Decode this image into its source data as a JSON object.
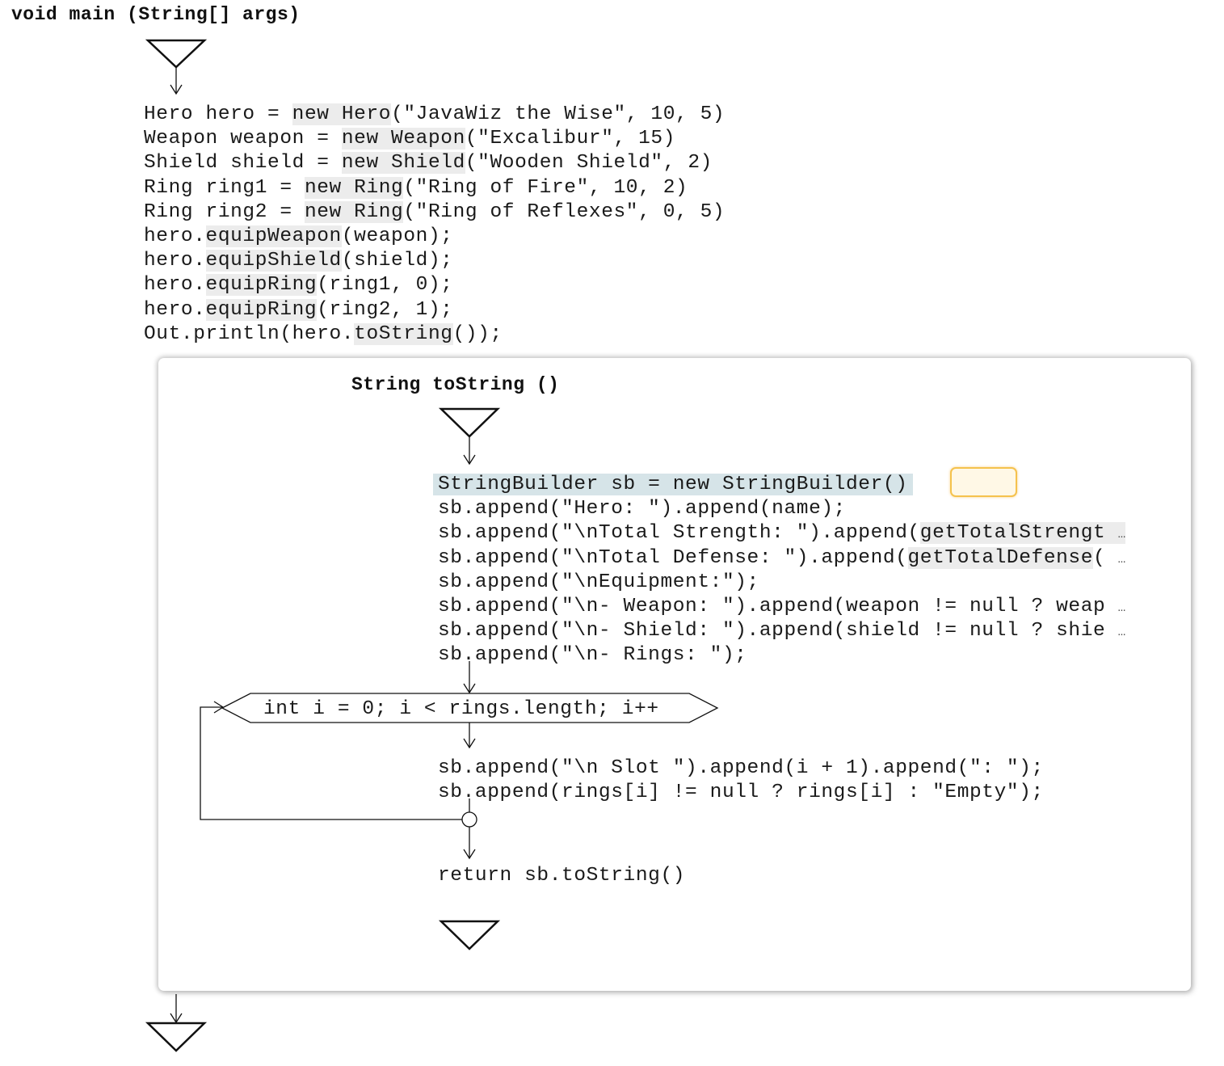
{
  "main_method": {
    "signature": "void main (String[] args)",
    "lines": [
      {
        "text": "Hero hero = new Hero(\"JavaWiz the Wise\", 10, 5)"
      },
      {
        "text": "Weapon weapon = new Weapon(\"Excalibur\", 15)"
      },
      {
        "text": "Shield shield = new Shield(\"Wooden Shield\", 2)"
      },
      {
        "text": "Ring ring1 = new Ring(\"Ring of Fire\", 10, 2)"
      },
      {
        "text": "Ring ring2 = new Ring(\"Ring of Reflexes\", 0, 5)"
      },
      {
        "text": "hero.equipWeapon(weapon);"
      },
      {
        "text": "hero.equipShield(shield);"
      },
      {
        "text": "hero.equipRing(ring1, 0);"
      },
      {
        "text": "hero.equipRing(ring2, 1);"
      },
      {
        "text": "Out.println(hero.toString());"
      }
    ]
  },
  "tostring_method": {
    "signature": "String toString ()",
    "lines_before_loop": [
      {
        "text": "StringBuilder sb = new StringBuilder()",
        "current": true
      },
      {
        "text": "sb.append(\"Hero: \").append(name);"
      },
      {
        "text": "sb.append(\"\\nTotal Strength: \").append(getTotalStrengt",
        "truncated": true
      },
      {
        "text": "sb.append(\"\\nTotal Defense: \").append(getTotalDefense(",
        "truncated": true
      },
      {
        "text": "sb.append(\"\\nEquipment:\");"
      },
      {
        "text": "sb.append(\"\\n- Weapon: \").append(weapon != null ? weap",
        "truncated": true
      },
      {
        "text": "sb.append(\"\\n- Shield: \").append(shield != null ? shie",
        "truncated": true
      },
      {
        "text": "sb.append(\"\\n- Rings: \");"
      }
    ],
    "loop": {
      "header": "int i = 0; i < rings.length; i++",
      "body": [
        {
          "text": "sb.append(\"\\n Slot \").append(i + 1).append(\": \");"
        },
        {
          "text": "sb.append(rings[i] != null ? rings[i] : \"Empty\");"
        }
      ]
    },
    "return_line": "return sb.toString()"
  },
  "ellipsis": "…",
  "colors": {
    "current_line_highlight": "#d6e4e8",
    "call_highlight": "#ececec",
    "tooltip_border": "#f5c24d",
    "tooltip_fill": "#fff8e6"
  }
}
